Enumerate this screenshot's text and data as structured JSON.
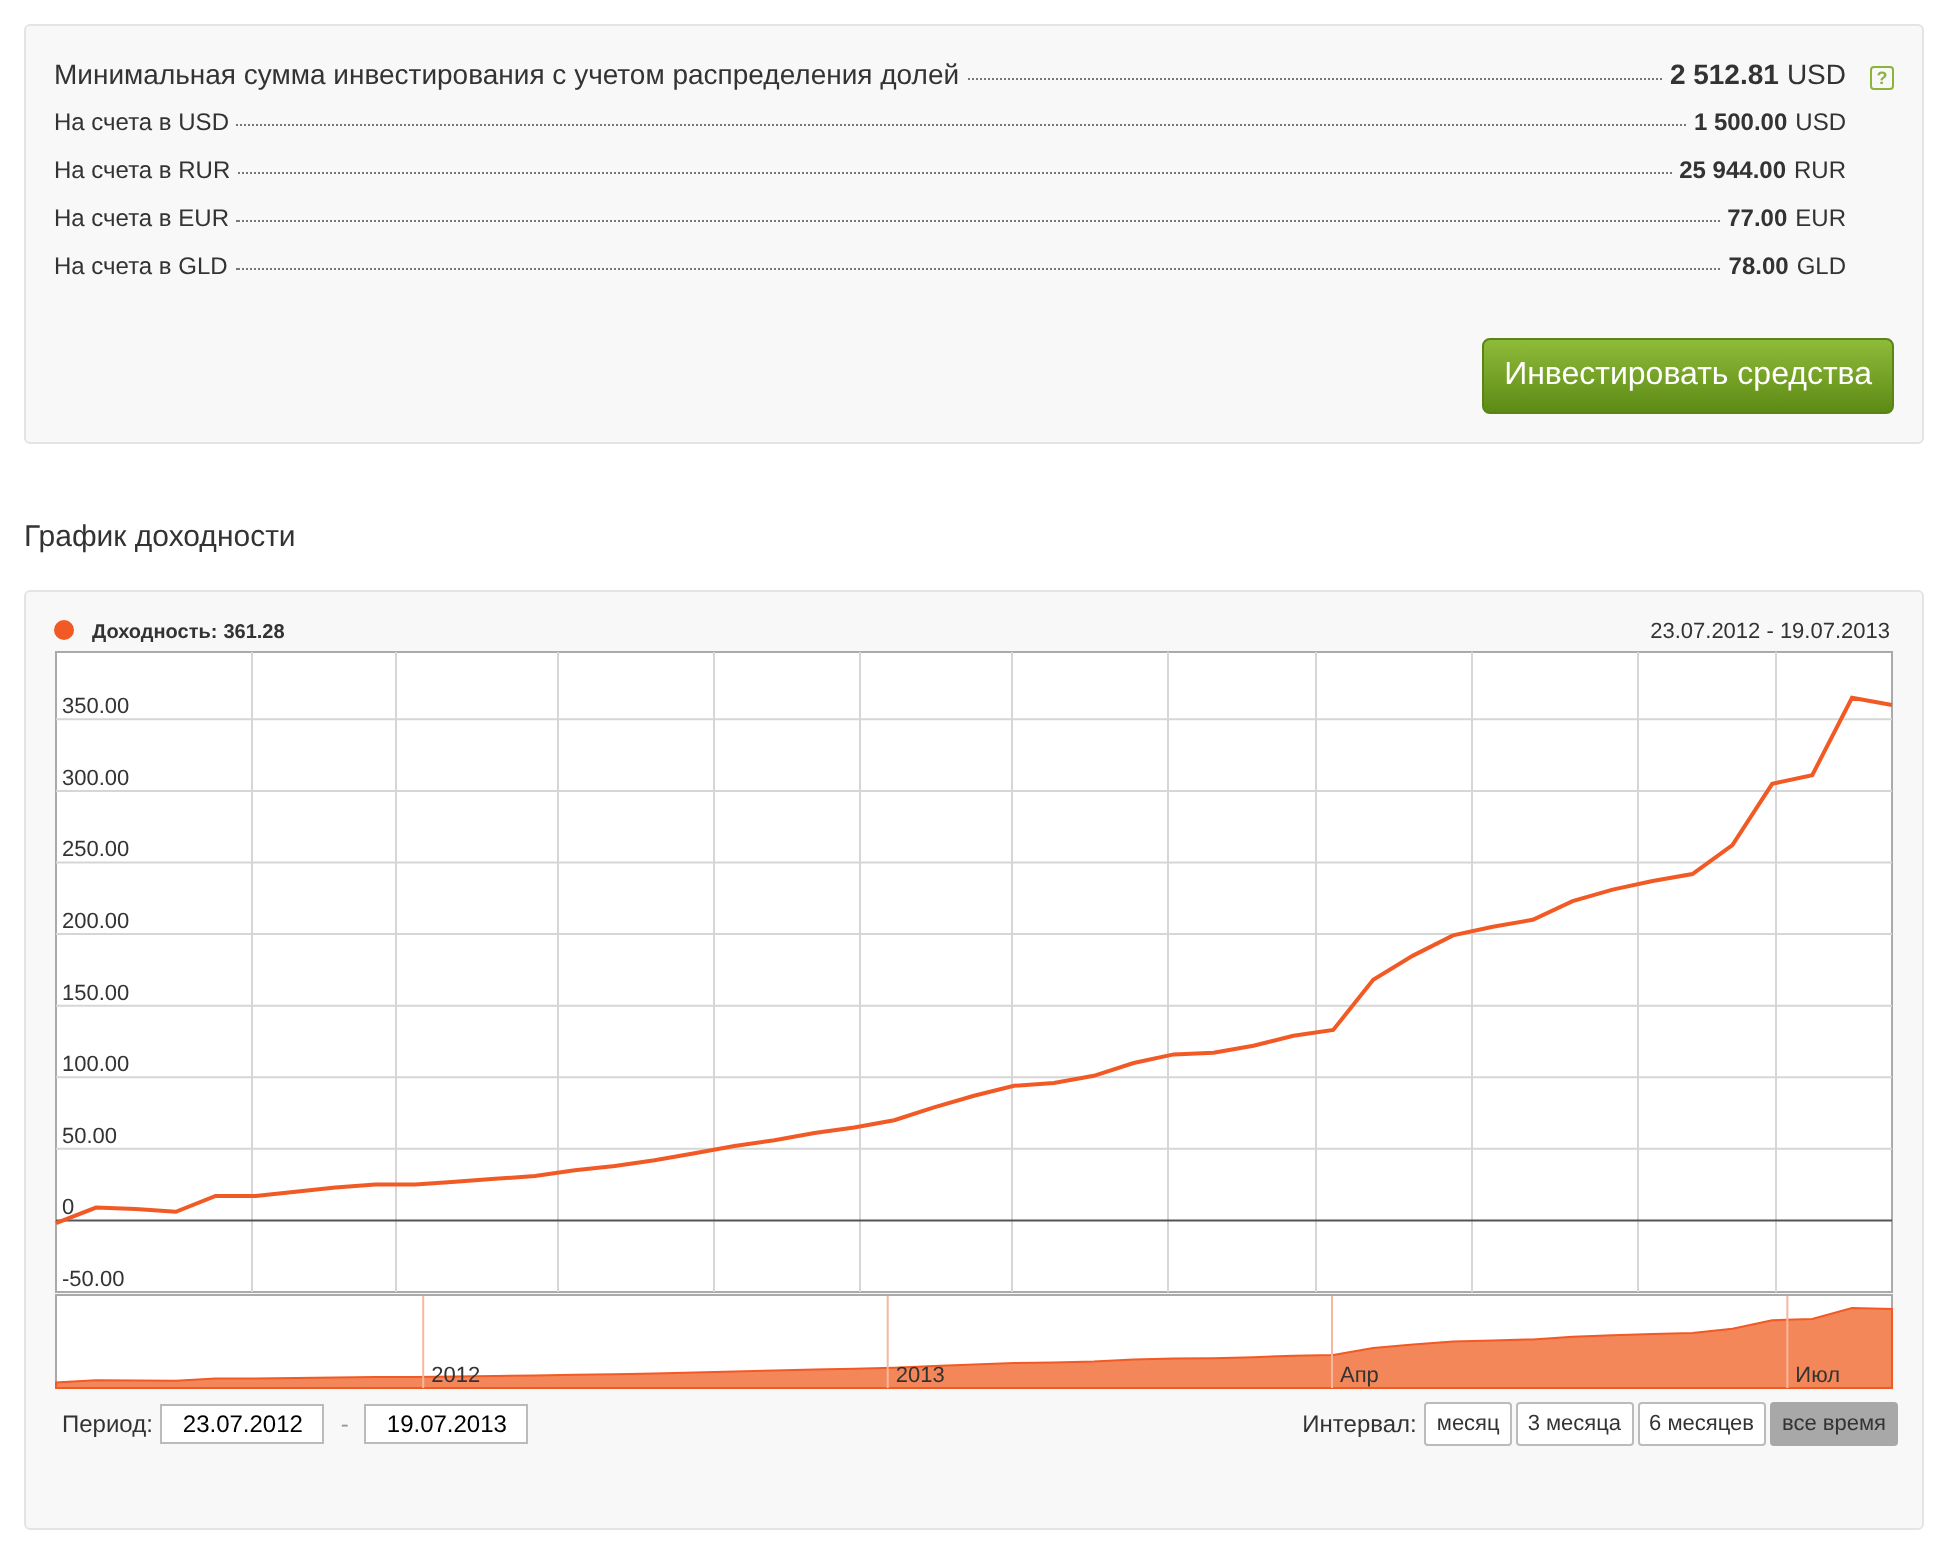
{
  "summary": {
    "rows": [
      {
        "kind": "total",
        "label": "Минимальная сумма инвестирования с учетом распределения долей",
        "amount": "2 512.81",
        "currency": "USD",
        "help": "?"
      },
      {
        "kind": "account",
        "label": "На счета в USD",
        "amount": "1 500.00",
        "currency": "USD"
      },
      {
        "kind": "account",
        "label": "На счета в RUR",
        "amount": "25 944.00",
        "currency": "RUR"
      },
      {
        "kind": "account",
        "label": "На счета в EUR",
        "amount": "77.00",
        "currency": "EUR"
      },
      {
        "kind": "account",
        "label": "На счета в GLD",
        "amount": "78.00",
        "currency": "GLD"
      }
    ],
    "invest_button": "Инвестировать средства"
  },
  "section_title": "График доходности",
  "chart": {
    "legend": {
      "separator": ":",
      "value": "361.28",
      "color": "#f15a24"
    },
    "date_range": "23.07.2012 - 19.07.2013",
    "chart_data": {
      "type": "line",
      "grid": true,
      "ylim": [
        -50,
        397
      ],
      "yticks": [
        {
          "value": -50,
          "label": "-50.00"
        },
        {
          "value": 0,
          "label": "0"
        },
        {
          "value": 50,
          "label": "50.00"
        },
        {
          "value": 100,
          "label": "100.00"
        },
        {
          "value": 150,
          "label": "150.00"
        },
        {
          "value": 200,
          "label": "200.00"
        },
        {
          "value": 250,
          "label": "250.00"
        },
        {
          "value": 300,
          "label": "300.00"
        },
        {
          "value": 350,
          "label": "350.00"
        }
      ],
      "series": [
        {
          "name": "Доходность",
          "color": "#f15a24",
          "values": [
            -2,
            9,
            8,
            6,
            17,
            17,
            20,
            23,
            25,
            25,
            27,
            29,
            31,
            35,
            38,
            42,
            47,
            52,
            56,
            61,
            65,
            70,
            79,
            87,
            94,
            96,
            101,
            110,
            116,
            117,
            122,
            129,
            133,
            168,
            185,
            199,
            205,
            210,
            223,
            231,
            237,
            242,
            262,
            305,
            311,
            365,
            360
          ]
        }
      ]
    },
    "navigator_labels": [
      "2012",
      "2013",
      "Апр",
      "Июл"
    ],
    "period": {
      "label": "Период:",
      "from": "23.07.2012",
      "separator": "-",
      "to": "19.07.2013"
    },
    "interval": {
      "label": "Интервал:",
      "options": [
        {
          "label": "месяц",
          "selected": false
        },
        {
          "label": "3 месяца",
          "selected": false
        },
        {
          "label": "6 месяцев",
          "selected": false
        },
        {
          "label": "все время",
          "selected": true
        }
      ]
    }
  }
}
